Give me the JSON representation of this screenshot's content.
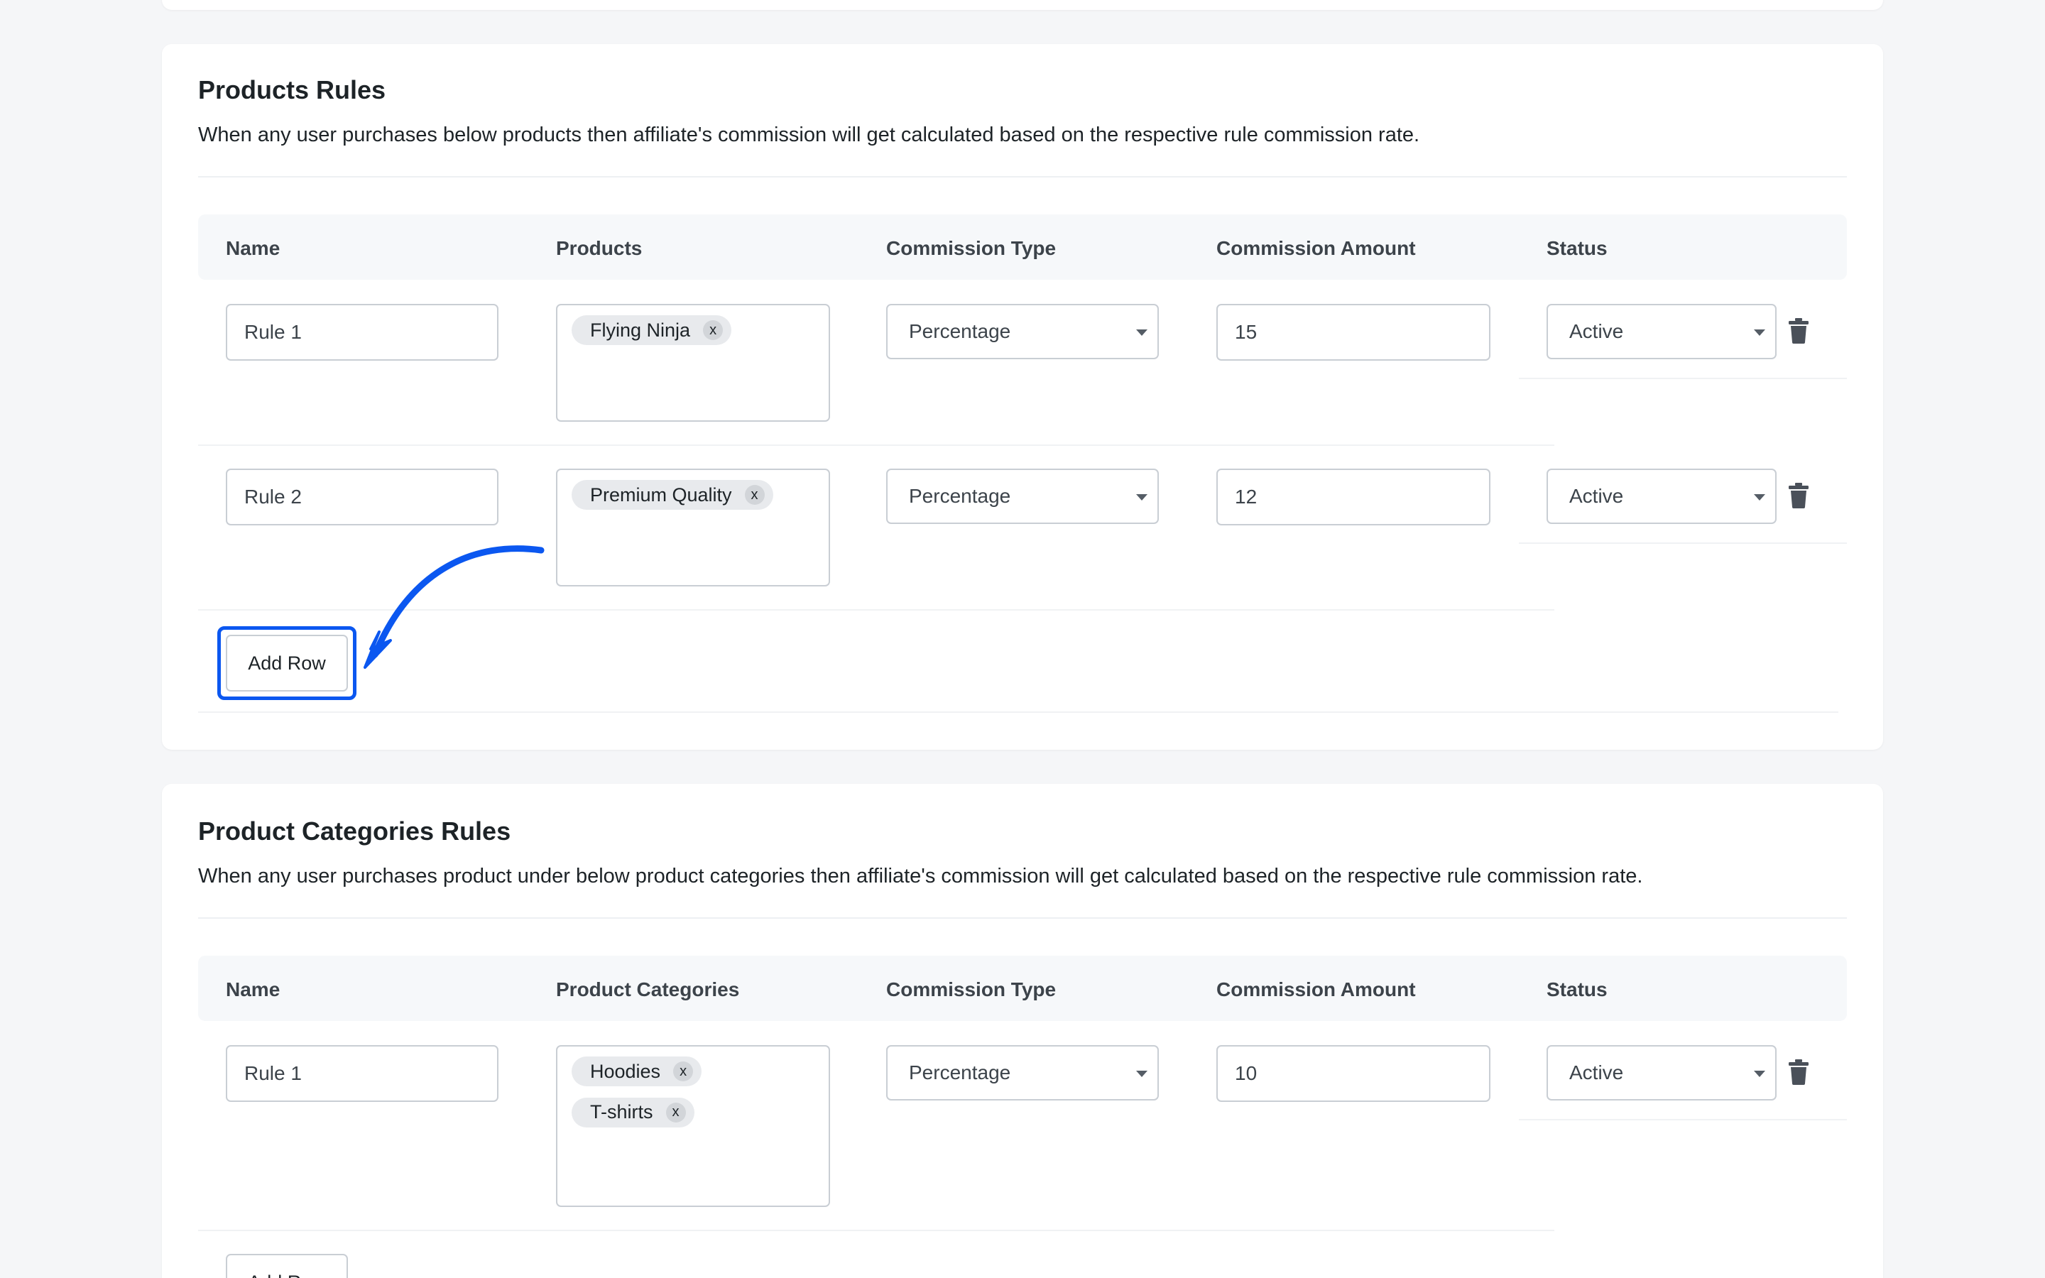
{
  "products_rules": {
    "title": "Products Rules",
    "description": "When any user purchases below products then affiliate's commission will get calculated based on the respective rule commission rate.",
    "columns": {
      "name": "Name",
      "items": "Products",
      "commission_type": "Commission Type",
      "commission_amount": "Commission Amount",
      "status": "Status"
    },
    "rows": [
      {
        "name": "Rule 1",
        "tags": [
          "Flying Ninja"
        ],
        "commission_type": "Percentage",
        "commission_amount": "15",
        "status": "Active"
      },
      {
        "name": "Rule 2",
        "tags": [
          "Premium Quality"
        ],
        "commission_type": "Percentage",
        "commission_amount": "12",
        "status": "Active"
      }
    ],
    "add_row_label": "Add Row"
  },
  "category_rules": {
    "title": "Product Categories Rules",
    "description": "When any user purchases product under below product categories then affiliate's commission will get calculated based on the respective rule commission rate.",
    "columns": {
      "name": "Name",
      "items": "Product Categories",
      "commission_type": "Commission Type",
      "commission_amount": "Commission Amount",
      "status": "Status"
    },
    "rows": [
      {
        "name": "Rule 1",
        "tags": [
          "Hoodies",
          "T-shirts"
        ],
        "commission_type": "Percentage",
        "commission_amount": "10",
        "status": "Active"
      }
    ],
    "add_row_label": "Add Row"
  },
  "tag_remove_glyph": "x",
  "colors": {
    "highlight": "#0b57f0",
    "annotation_arrow": "#0b57f0",
    "trash_icon": "#4a5059"
  },
  "icons": {
    "delete_row": "trash-icon",
    "tag_remove": "close-icon",
    "select_caret": "caret-down-icon",
    "annotation": "curved-arrow-icon"
  }
}
